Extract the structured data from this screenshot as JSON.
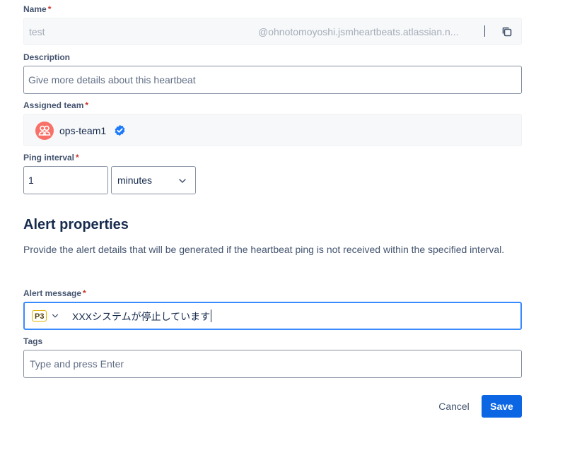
{
  "form": {
    "name": {
      "label": "Name",
      "required_mark": "*",
      "value": "test",
      "suffix": "@ohnotomoyoshi.jsmheartbeats.atlassian.n...",
      "copy_icon": "copy-icon"
    },
    "description": {
      "label": "Description",
      "placeholder": "Give more details about this heartbeat"
    },
    "assigned_team": {
      "label": "Assigned team",
      "required_mark": "*",
      "team_name": "ops-team1",
      "avatar_icon": "team-avatar-icon",
      "verified_icon": "verified-badge-icon"
    },
    "ping_interval": {
      "label": "Ping interval",
      "required_mark": "*",
      "value": "1",
      "unit": "minutes"
    }
  },
  "alert": {
    "heading": "Alert properties",
    "description": "Provide the alert details that will be generated if the heartbeat ping is not received within the specified interval.",
    "message": {
      "label": "Alert message",
      "required_mark": "*",
      "priority": "P3",
      "value": "XXXシステムが停止しています"
    },
    "tags": {
      "label": "Tags",
      "placeholder": "Type and press Enter"
    }
  },
  "actions": {
    "cancel_label": "Cancel",
    "save_label": "Save"
  },
  "colors": {
    "primary": "#0c66e4",
    "required": "#c9372c",
    "focus_border": "#388bff",
    "avatar": "#f87168"
  }
}
